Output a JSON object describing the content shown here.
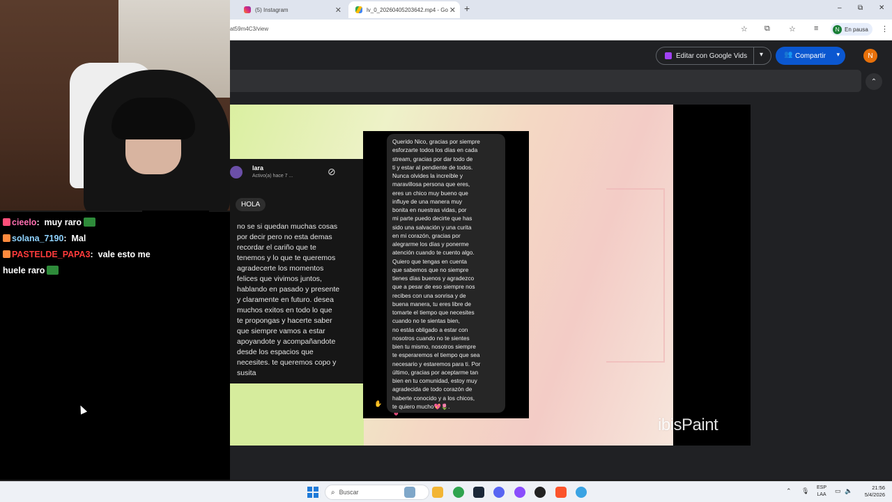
{
  "browser": {
    "tabs": [
      {
        "title": "(5) Instagram",
        "active": false,
        "favicon": "instagram-icon"
      },
      {
        "title": "lv_0_20260405203642.mp4 - Go",
        "active": true,
        "favicon": "google-drive-icon"
      }
    ],
    "new_tab": "+",
    "window_controls": {
      "minimize": "–",
      "maximize": "⧉",
      "close": "✕"
    },
    "url": "at59m4C3/view",
    "profile": {
      "initial": "N",
      "status": "En pausa"
    },
    "menu": "⋮"
  },
  "drive": {
    "vids_button": "Editar con Google Vids",
    "share_button": "Compartir",
    "user_initial": "N",
    "collapse_icon": "⌃"
  },
  "video": {
    "instagram": {
      "name": "lara",
      "status": "Activo(a) hace 7 ...",
      "hola": "HOLA",
      "message": "no se si quedan muchas cosas\npor decir pero no esta demas\nrecordar el cariño que te\ntenemos y lo que te queremos\nagradecerte los momentos\nfelices que vivimos juntos,\nhablando en pasado y presente\ny claramente en futuro. desea\nmuchos exitos en todo lo que\nte propongas y hacerte saber\nque siempre vamos a estar\napoyandote y acompañandote\ndesde los espacios que\nnecesites. te queremos copo y\nsusita"
    },
    "dm": {
      "message": "Querido Nico, gracias por siempre\nesforzarte todos los días en cada\nstream, gracias por dar todo de\nti y estar al pendiente de todos.\nNunca olvides la increíble y\nmaravillosa persona que eres,\neres un chico muy bueno que\ninfluye de una manera muy\nbonita en nuestras vidas, por\nmi parte puedo decirte que has\nsido una salvación y una curita\nen mi corazón,  gracias por\nalegrarme los días y ponerme\natención cuando te cuento algo.\nQuiero que tengas en cuenta\nque sabemos que no siempre\ntienes días buenos y agradezco\nque a pesar de eso siempre nos\nrecibes con una sonrisa y de\nbuena manera, tu eres libre de\ntomarte el tiempo que necesites\ncuando no te sientas bien,\nno estás obligado a estar con\nnosotros cuando no te sientes\nbien tu mismo, nosotros siempre\nte esperaremos el tiempo que sea\nnecesario y estaremos para ti. Por\núltimo, gracias por aceptarme tan\nbien en tu comunidad, estoy muy\nagradecida de todo corazón de\nhaberte conocido y a los chicos,\nte quiero mucho💖🌷."
    },
    "watermark": "ibisPaint"
  },
  "chat": {
    "messages": [
      {
        "user": "cieelo",
        "text": "muy raro",
        "color": "#ff6fb0"
      },
      {
        "user": "solana_7190",
        "text": "Mal",
        "color": "#8fd3ff"
      },
      {
        "user": "PASTELDE_PAPA3",
        "text": "vale esto me",
        "continuation": "huele raro",
        "color": "#ff3b3b"
      }
    ]
  },
  "taskbar": {
    "search_placeholder": "Buscar",
    "lang": "ESP",
    "lang_sub": "LAA",
    "time": "21:56",
    "date": "5/4/2026"
  }
}
